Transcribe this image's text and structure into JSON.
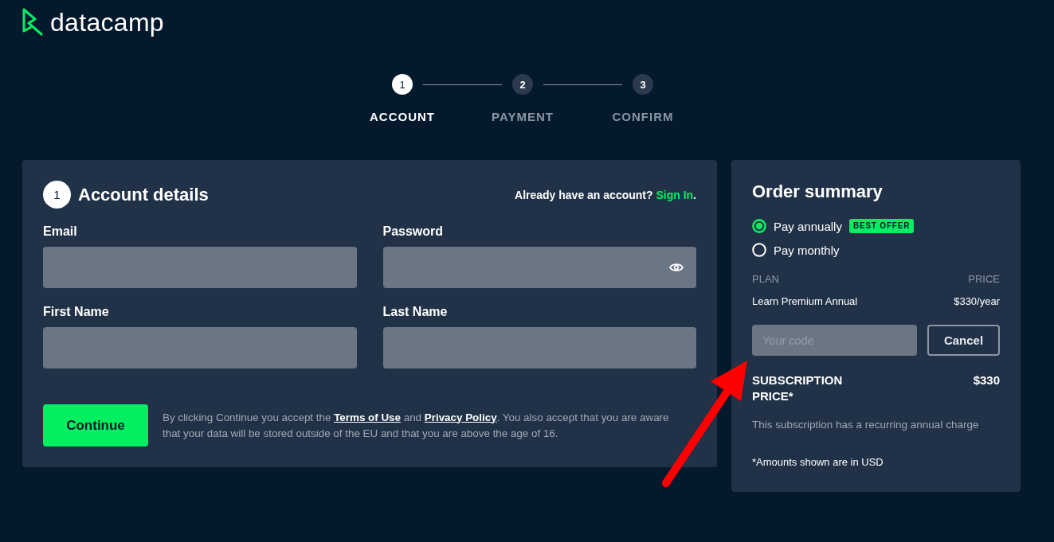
{
  "logo": {
    "wordmark": "datacamp"
  },
  "stepper": {
    "steps": [
      {
        "number": "1",
        "label": "ACCOUNT",
        "selected": true
      },
      {
        "number": "2",
        "label": "PAYMENT",
        "selected": false
      },
      {
        "number": "3",
        "label": "CONFIRM",
        "selected": false
      }
    ]
  },
  "account_details": {
    "step_number": "1",
    "title": "Account details",
    "sign_in": {
      "prompt": "Already have an account?",
      "link": "Sign In",
      "suffix": "."
    },
    "fields": [
      {
        "label": "Email",
        "kind": "text"
      },
      {
        "label": "Password",
        "kind": "password"
      },
      {
        "label": "First Name",
        "kind": "text"
      },
      {
        "label": "Last Name",
        "kind": "text"
      }
    ],
    "continue_button": "Continue",
    "terms": [
      {
        "kind": "text",
        "text": "By clicking Continue you accept the"
      },
      {
        "kind": "link",
        "text": "Terms of Use"
      },
      {
        "kind": "text",
        "text": "and"
      },
      {
        "kind": "link",
        "text": "Privacy Policy"
      },
      {
        "kind": "text",
        "text": ". You also accept that you are aware that your data will be stored outside of the EU and that you are above the age of 16."
      }
    ]
  },
  "order_summary": {
    "title": "Order summary",
    "billing_options": [
      {
        "label": "Pay annually",
        "selected": true,
        "badge": "BEST OFFER"
      },
      {
        "label": "Pay monthly",
        "selected": false
      }
    ],
    "plan_table": {
      "columns": [
        "PLAN",
        "PRICE"
      ],
      "rows": [
        [
          "Learn Premium Annual",
          "$330/year"
        ]
      ]
    },
    "promo_code": {
      "placeholder": "Your code"
    },
    "cancel_button": "Cancel",
    "total": {
      "label": "SUBSCRIPTION PRICE*",
      "amount": "$330"
    },
    "recurring_note": "This subscription has a recurring annual charge",
    "currency_note": "*Amounts shown are in USD"
  }
}
